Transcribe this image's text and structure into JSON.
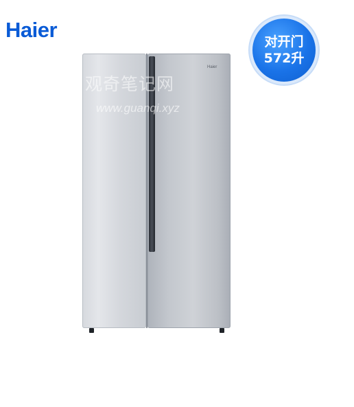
{
  "brand": {
    "logo_text": "Haier",
    "color": "#0a5bd6"
  },
  "badge": {
    "line1": "对开门",
    "line2": "572升",
    "color": "#1a73e8"
  },
  "product": {
    "door_logo": "Haier"
  },
  "watermark": {
    "text_cn": "观奇笔记网",
    "url": "www.guanqi.xyz"
  }
}
